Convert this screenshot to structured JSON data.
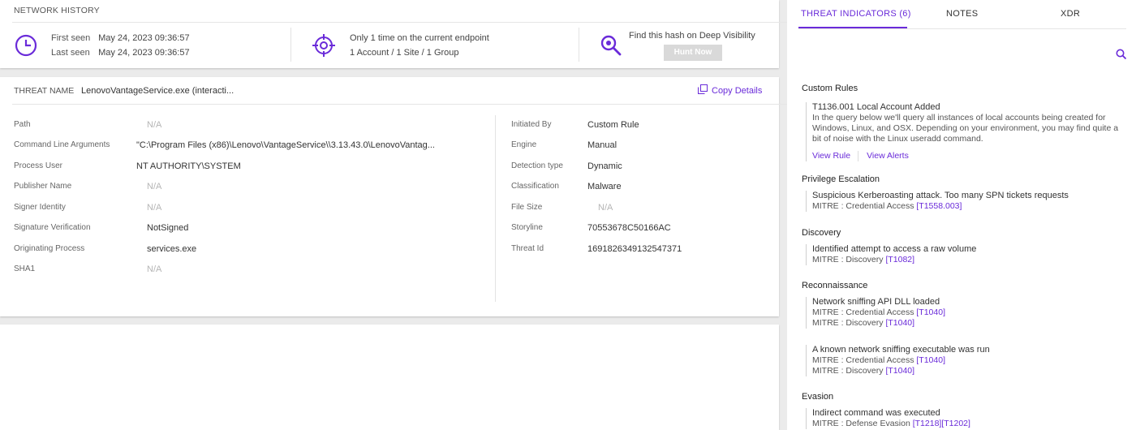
{
  "network_history": {
    "title": "NETWORK HISTORY",
    "first_seen_label": "First seen",
    "first_seen_value": "May 24, 2023 09:36:57",
    "last_seen_label": "Last seen",
    "last_seen_value": "May 24, 2023 09:36:57",
    "endpoint_text": "Only 1 time on the current endpoint",
    "scope_text": "1 Account / 1 Site / 1 Group",
    "find_hash_text": "Find this hash on Deep Visibility",
    "hunt_button": "Hunt Now",
    "icons": [
      "clock-icon",
      "crosshair-icon",
      "search-icon"
    ]
  },
  "threat": {
    "name_label": "THREAT NAME",
    "name_value": "LenovoVantageService.exe (interacti...",
    "copy_label": "Copy Details",
    "left_fields": [
      {
        "label": "Path",
        "value": "N/A",
        "na": true
      },
      {
        "label": "Command Line Arguments",
        "value": "\"C:\\Program Files (x86)\\Lenovo\\VantageService\\\\3.13.43.0\\LenovoVantag...",
        "na": false
      },
      {
        "label": "Process User",
        "value": "NT AUTHORITY\\SYSTEM",
        "na": false
      },
      {
        "label": "Publisher Name",
        "value": "N/A",
        "na": true
      },
      {
        "label": "Signer Identity",
        "value": "N/A",
        "na": true
      },
      {
        "label": "Signature Verification",
        "value": "NotSigned",
        "na": false
      },
      {
        "label": "Originating Process",
        "value": "services.exe",
        "na": false
      },
      {
        "label": "SHA1",
        "value": "N/A",
        "na": true
      }
    ],
    "right_fields": [
      {
        "label": "Initiated By",
        "value": "Custom Rule",
        "na": false
      },
      {
        "label": "Engine",
        "value": "Manual",
        "na": false
      },
      {
        "label": "Detection type",
        "value": "Dynamic",
        "na": false
      },
      {
        "label": "Classification",
        "value": "Malware",
        "na": false
      },
      {
        "label": "File Size",
        "value": "N/A",
        "na": true
      },
      {
        "label": "Storyline",
        "value": "70553678C50166AC",
        "na": false
      },
      {
        "label": "Threat Id",
        "value": "1691826349132547371",
        "na": false
      }
    ]
  },
  "panel": {
    "tabs": [
      "THREAT INDICATORS (6)",
      "NOTES",
      "XDR"
    ],
    "active_tab": 0,
    "custom_rules": {
      "title": "Custom Rules",
      "rule_title": "T1136.001 Local Account Added",
      "rule_desc": "In the query below we'll query all instances of local accounts being created for Windows, Linux, and OSX. Depending on your environment, you may find quite a bit of noise with the Linux useradd command.",
      "view_rule": "View Rule",
      "view_alerts": "View Alerts"
    },
    "sections": [
      {
        "title": "Privilege Escalation",
        "items": [
          {
            "title": "Suspicious Kerberoasting attack. Too many SPN tickets requests",
            "mitre": [
              {
                "prefix": "MITRE : Credential Access ",
                "techs": [
                  "[T1558.003]"
                ]
              }
            ]
          }
        ]
      },
      {
        "title": "Discovery",
        "items": [
          {
            "title": "Identified attempt to access a raw volume",
            "mitre": [
              {
                "prefix": "MITRE : Discovery ",
                "techs": [
                  "[T1082]"
                ]
              }
            ]
          }
        ]
      },
      {
        "title": "Reconnaissance",
        "items": [
          {
            "title": "Network sniffing API DLL loaded",
            "mitre": [
              {
                "prefix": "MITRE : Credential Access ",
                "techs": [
                  "[T1040]"
                ]
              },
              {
                "prefix": "MITRE : Discovery ",
                "techs": [
                  "[T1040]"
                ]
              }
            ]
          },
          {
            "title": "A known network sniffing executable was run",
            "mitre": [
              {
                "prefix": "MITRE : Credential Access ",
                "techs": [
                  "[T1040]"
                ]
              },
              {
                "prefix": "MITRE : Discovery ",
                "techs": [
                  "[T1040]"
                ]
              }
            ]
          }
        ]
      },
      {
        "title": "Evasion",
        "items": [
          {
            "title": "Indirect command was executed",
            "mitre": [
              {
                "prefix": "MITRE : Defense Evasion ",
                "techs": [
                  "[T1218]",
                  "[T1202]"
                ]
              }
            ]
          }
        ]
      }
    ]
  },
  "colors": {
    "accent": "#6a2bd9",
    "na_text": "#b5b5b5",
    "button_disabled": "#d9d9d9"
  }
}
